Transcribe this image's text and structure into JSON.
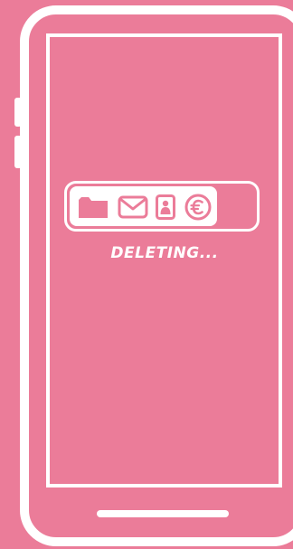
{
  "status": {
    "label": "DELETING..."
  },
  "progress": {
    "fraction": 0.8
  },
  "icons": [
    "folder-icon",
    "mail-icon",
    "contact-icon",
    "euro-icon"
  ],
  "colors": {
    "background": "#EB7C99",
    "foreground": "#FFFFFF"
  }
}
